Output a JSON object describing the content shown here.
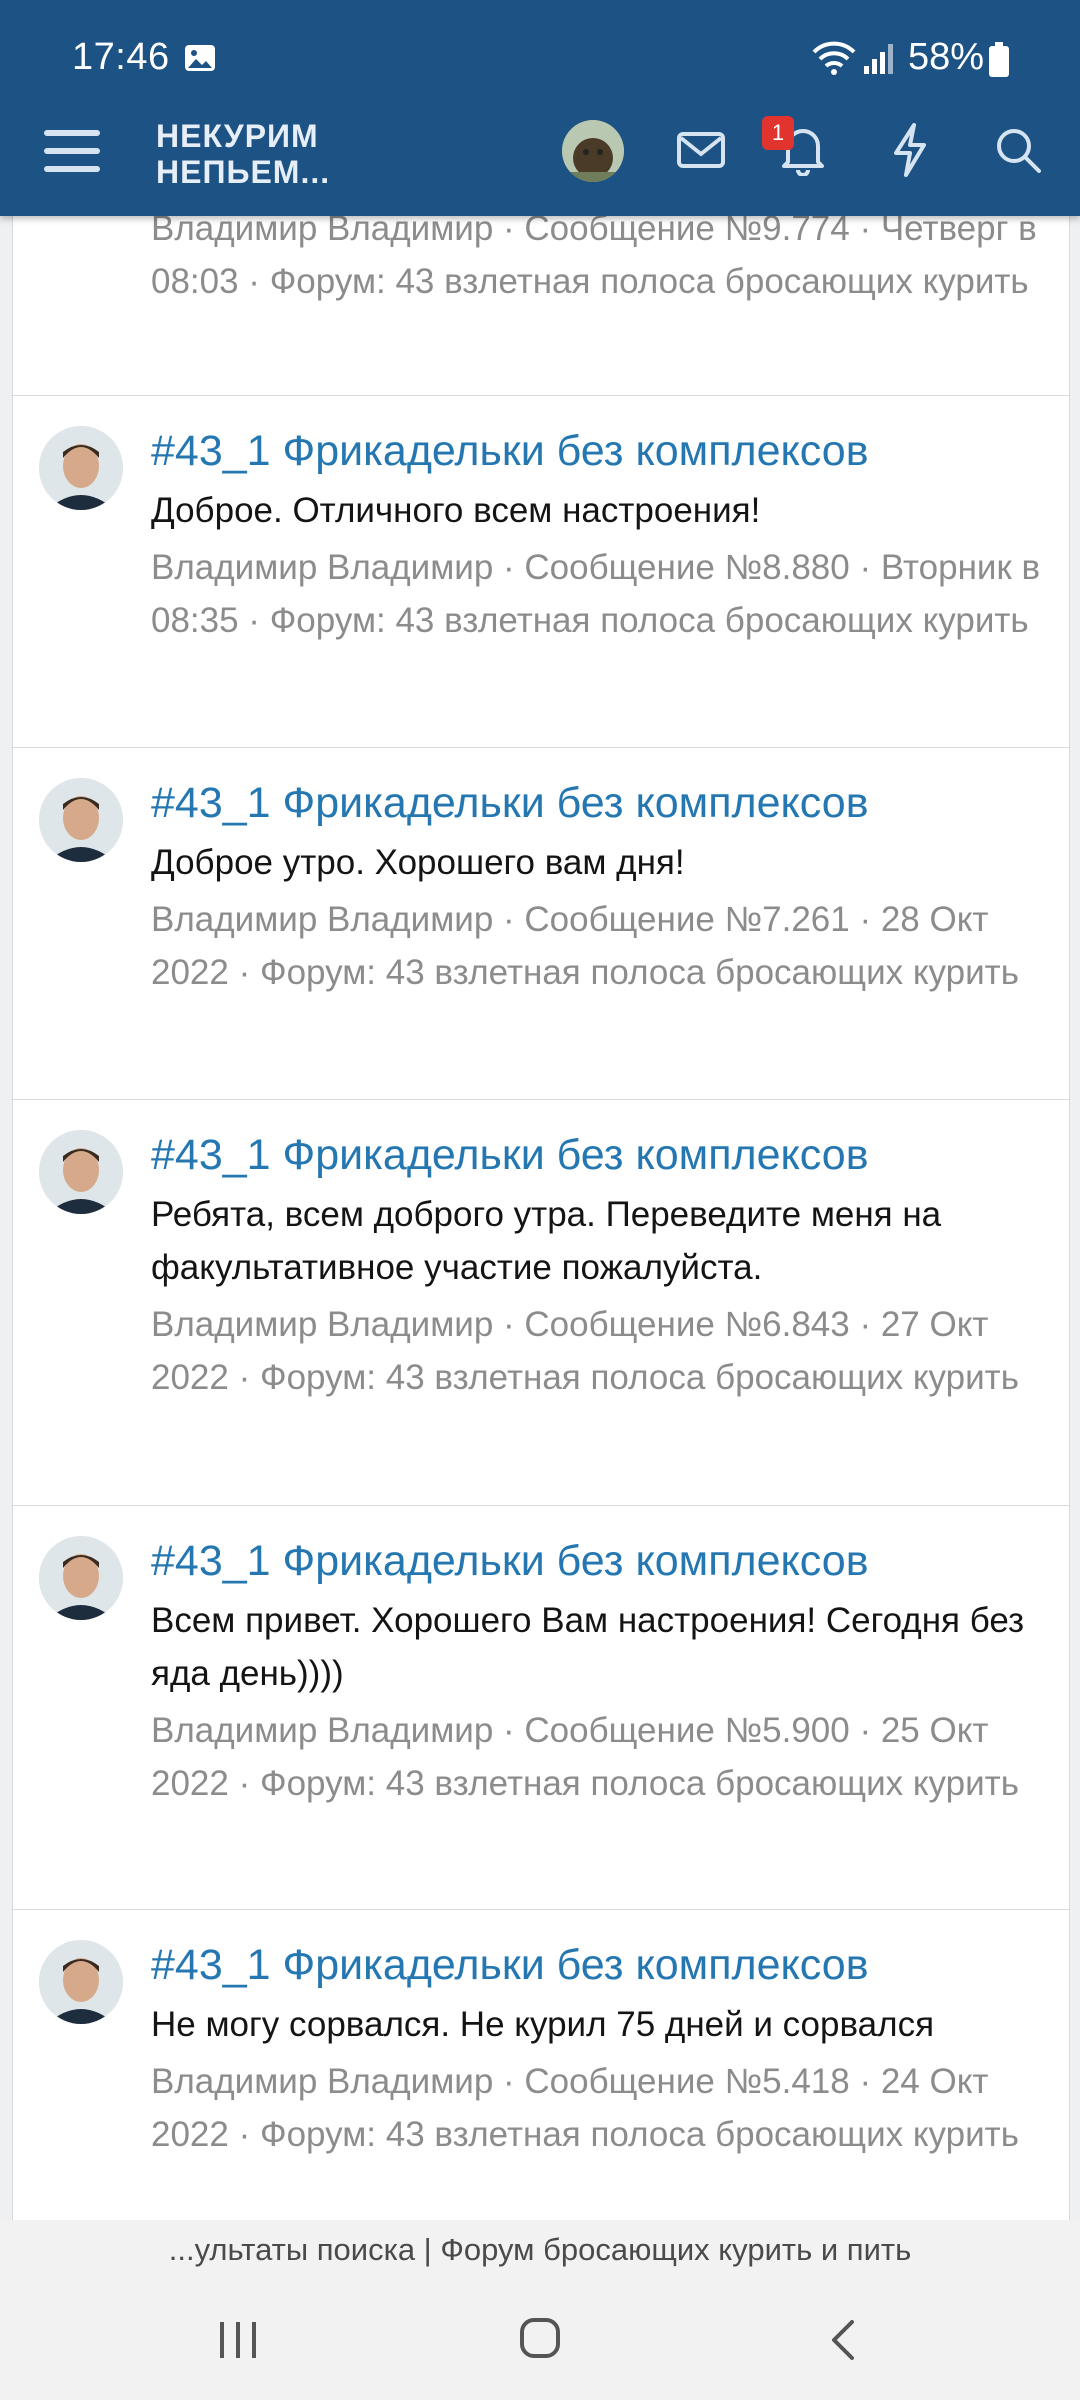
{
  "status_bar": {
    "time": "17:46",
    "battery": "58%"
  },
  "header": {
    "logo_line1": "НЕКУРИМ",
    "logo_line2": "НЕПЬЕМ...",
    "notification_count": "1",
    "accent_color": "#1d5284",
    "badge_color": "#e2342f"
  },
  "first_item": {
    "meta": "Владимир Владимир · Сообщение №9.774 · Четверг в 08:03 · Форум: 43 взлетная полоса бросающих курить"
  },
  "results": [
    {
      "title": "#43_1 Фрикадельки без комплексов",
      "snippet": "Доброе. Отличного всем настроения!",
      "meta": "Владимир Владимир · Сообщение №8.880 · Вторник в 08:35 · Форум: 43 взлетная полоса бросающих курить"
    },
    {
      "title": "#43_1 Фрикадельки без комплексов",
      "snippet": "Доброе утро. Хорошего вам дня!",
      "meta": "Владимир Владимир · Сообщение №7.261 · 28 Окт 2022 · Форум: 43 взлетная полоса бросающих курить"
    },
    {
      "title": "#43_1 Фрикадельки без комплексов",
      "snippet": "Ребята, всем доброго утра. Переведите меня на факультативное участие пожалуйста.",
      "meta": "Владимир Владимир · Сообщение №6.843 · 27 Окт 2022 · Форум: 43 взлетная полоса бросающих курить"
    },
    {
      "title": "#43_1 Фрикадельки без комплексов",
      "snippet": "Всем привет. Хорошего Вам настроения! Сегодня без яда день))))",
      "meta": "Владимир Владимир · Сообщение №5.900 · 25 Окт 2022 · Форум: 43 взлетная полоса бросающих курить"
    },
    {
      "title": "#43_1 Фрикадельки без комплексов",
      "snippet": "Не могу сорвался. Не курил 75 дней и сорвался",
      "meta": "Владимир Владимир · Сообщение №5.418 · 24 Окт 2022 · Форум: 43 взлетная полоса бросающих курить"
    }
  ],
  "browser": {
    "page_title": "...ультаты поиска | Форум бросающих курить и пить"
  }
}
